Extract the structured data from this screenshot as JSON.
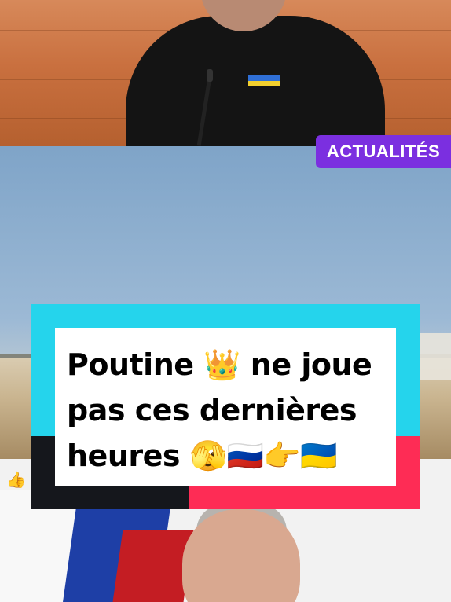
{
  "badge": {
    "label": "ACTUALITÉS",
    "color": "#7b2fe0"
  },
  "overlay": {
    "title_line1": "Poutine 👑 ne joue",
    "title_line2": "pas ces dernières",
    "title_line3": "heures 🫣🇷🇺👉🇺🇦",
    "frame_colors": {
      "cyan": "#25d4ec",
      "dark": "#15171c",
      "pink": "#fe2c55"
    }
  },
  "icons": {
    "like": "thumbs-up-icon"
  }
}
